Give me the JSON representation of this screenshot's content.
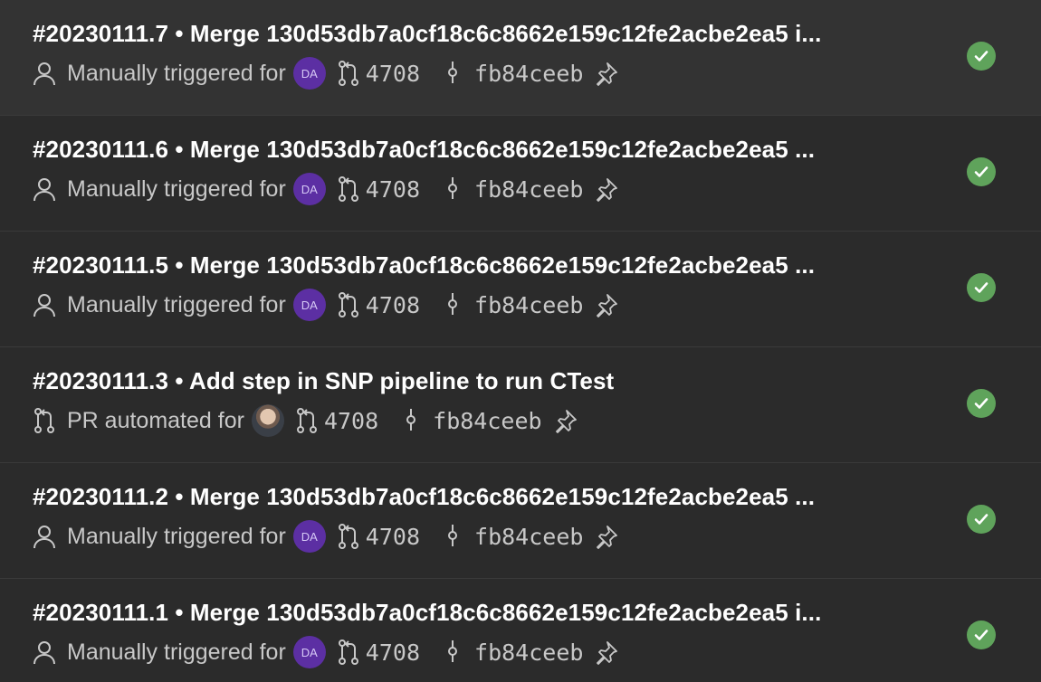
{
  "runs": [
    {
      "title": "#20230111.7 • Merge 130d53db7a0cf18c6c8662e159c12fe2acbe2ea5 i...",
      "trigger_icon": "person-icon",
      "trigger_text": "Manually triggered for",
      "avatar": "DA",
      "pr_number": "4708",
      "commit": "fb84ceeb",
      "status": "succeeded"
    },
    {
      "title": "#20230111.6 • Merge 130d53db7a0cf18c6c8662e159c12fe2acbe2ea5 ...",
      "trigger_icon": "person-icon",
      "trigger_text": "Manually triggered for",
      "avatar": "DA",
      "pr_number": "4708",
      "commit": "fb84ceeb",
      "status": "succeeded"
    },
    {
      "title": "#20230111.5 • Merge 130d53db7a0cf18c6c8662e159c12fe2acbe2ea5 ...",
      "trigger_icon": "person-icon",
      "trigger_text": "Manually triggered for",
      "avatar": "DA",
      "pr_number": "4708",
      "commit": "fb84ceeb",
      "status": "succeeded"
    },
    {
      "title": "#20230111.3 • Add step in SNP pipeline to run CTest",
      "trigger_icon": "pull-request-icon",
      "trigger_text": "PR automated for",
      "avatar": "",
      "pr_number": "4708",
      "commit": "fb84ceeb",
      "status": "succeeded"
    },
    {
      "title": "#20230111.2 • Merge 130d53db7a0cf18c6c8662e159c12fe2acbe2ea5 ...",
      "trigger_icon": "person-icon",
      "trigger_text": "Manually triggered for",
      "avatar": "DA",
      "pr_number": "4708",
      "commit": "fb84ceeb",
      "status": "succeeded"
    },
    {
      "title": "#20230111.1 • Merge 130d53db7a0cf18c6c8662e159c12fe2acbe2ea5 i...",
      "trigger_icon": "person-icon",
      "trigger_text": "Manually triggered for",
      "avatar": "DA",
      "pr_number": "4708",
      "commit": "fb84ceeb",
      "status": "succeeded"
    }
  ],
  "colors": {
    "background": "#2b2b2b",
    "selected_row": "#333333",
    "success": "#5fa35b",
    "avatar": "#5c2fa3"
  }
}
